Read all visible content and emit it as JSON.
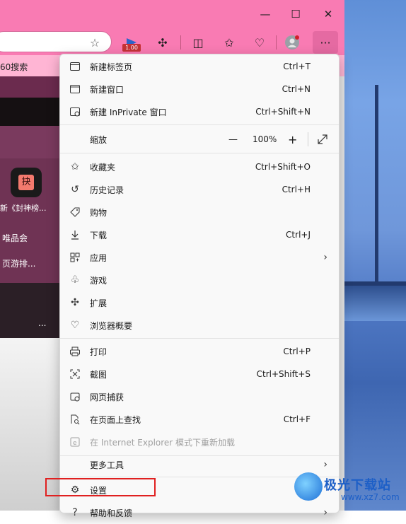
{
  "toolbar": {
    "badge": "1.00",
    "favorites_bar_item": "60搜索"
  },
  "page": {
    "app_tile_glyph": "抉",
    "app_tile_caption": "新《封神榜...",
    "link1": "唯品会",
    "link2": "页游排...",
    "more": "..."
  },
  "menu": {
    "new_tab": {
      "label": "新建标签页",
      "shortcut": "Ctrl+T"
    },
    "new_window": {
      "label": "新建窗口",
      "shortcut": "Ctrl+N"
    },
    "new_inprivate": {
      "label": "新建 InPrivate 窗口",
      "shortcut": "Ctrl+Shift+N"
    },
    "zoom": {
      "label": "缩放",
      "value": "100%",
      "minus": "—",
      "plus": "+"
    },
    "favorites": {
      "label": "收藏夹",
      "shortcut": "Ctrl+Shift+O"
    },
    "history": {
      "label": "历史记录",
      "shortcut": "Ctrl+H"
    },
    "shopping": {
      "label": "购物"
    },
    "downloads": {
      "label": "下载",
      "shortcut": "Ctrl+J"
    },
    "apps": {
      "label": "应用"
    },
    "games": {
      "label": "游戏"
    },
    "extensions": {
      "label": "扩展"
    },
    "browser_essentials": {
      "label": "浏览器概要"
    },
    "print": {
      "label": "打印",
      "shortcut": "Ctrl+P"
    },
    "screenshot": {
      "label": "截图",
      "shortcut": "Ctrl+Shift+S"
    },
    "web_capture": {
      "label": "网页捕获"
    },
    "find": {
      "label": "在页面上查找",
      "shortcut": "Ctrl+F"
    },
    "ie_mode": {
      "label": "在 Internet Explorer 模式下重新加载"
    },
    "more_tools": {
      "label": "更多工具"
    },
    "settings": {
      "label": "设置"
    },
    "help": {
      "label": "帮助和反馈"
    }
  },
  "watermark": {
    "title": "极光下载站",
    "url": "www.xz7.com"
  },
  "colors": {
    "titlebar": "#f97bb3",
    "favbar": "#ffb5d4",
    "highlight": "#e02020"
  }
}
